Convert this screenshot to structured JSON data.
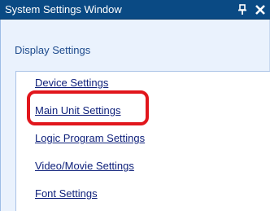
{
  "window": {
    "title": "System Settings Window",
    "pin_glyph": "⫪",
    "close_glyph": "✕"
  },
  "section": {
    "header": "Display Settings"
  },
  "links": [
    {
      "label": "Device Settings"
    },
    {
      "label": "Main Unit Settings"
    },
    {
      "label": "Logic Program Settings"
    },
    {
      "label": "Video/Movie Settings"
    },
    {
      "label": "Font Settings"
    }
  ],
  "colors": {
    "titlebar": "#0a4a84",
    "content_bg": "#eaf2fd",
    "link": "#0d1f7a",
    "header_text": "#1d4a8c",
    "highlight": "#e1161c"
  },
  "icons": {
    "pin": "pin-icon",
    "close": "close-icon"
  }
}
